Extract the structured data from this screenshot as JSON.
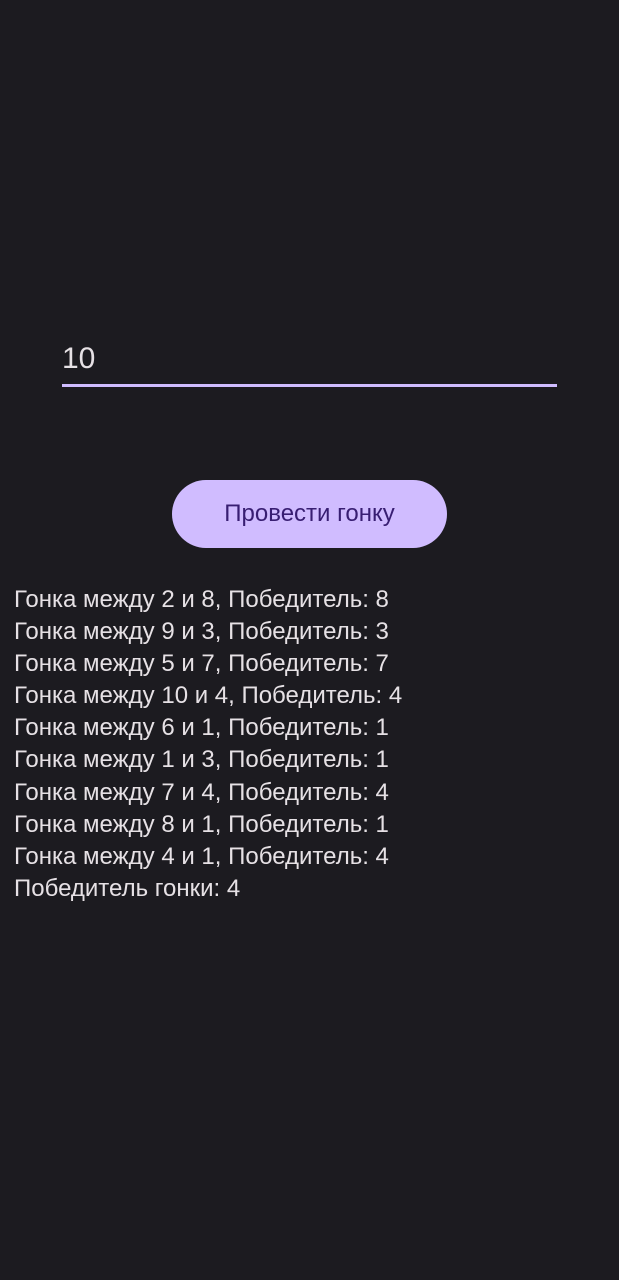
{
  "input": {
    "value": "10"
  },
  "button": {
    "label": "Провести гонку"
  },
  "results": [
    "Гонка между 2 и 8, Победитель: 8",
    "Гонка между 9 и 3, Победитель: 3",
    "Гонка между 5 и 7, Победитель: 7",
    "Гонка между 10 и 4, Победитель: 4",
    "Гонка между 6 и 1, Победитель: 1",
    "Гонка между 1 и 3, Победитель: 1",
    "Гонка между 7 и 4, Победитель: 4",
    "Гонка между 8 и 1, Победитель: 1",
    "Гонка между 4 и 1, Победитель: 4",
    "Победитель гонки: 4"
  ],
  "colors": {
    "background": "#1c1b20",
    "accent": "#d0bcff",
    "button_text": "#381e72",
    "text": "#e6e1e5"
  }
}
